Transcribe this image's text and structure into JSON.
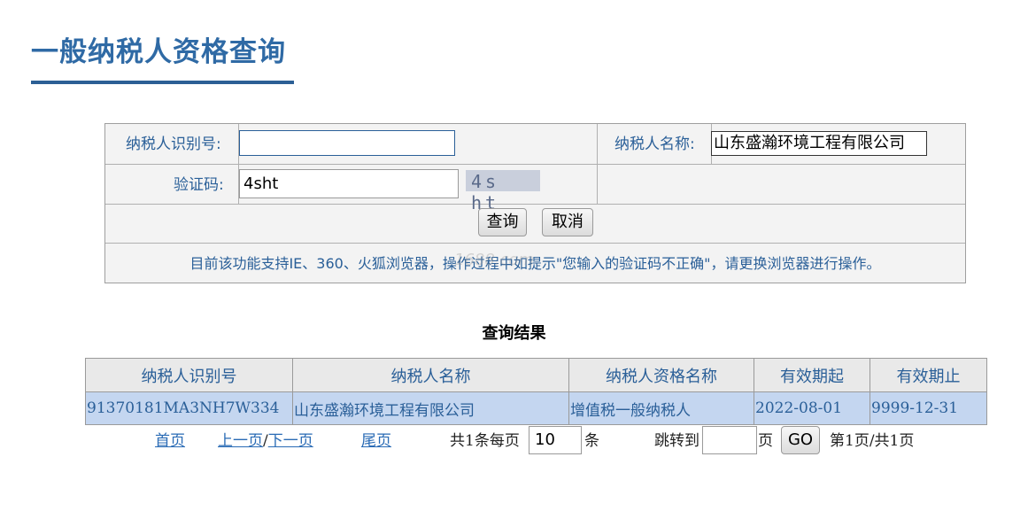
{
  "page": {
    "title": "一般纳税人资格查询"
  },
  "form": {
    "taxpayer_id_label": "纳税人识别号:",
    "taxpayer_id_value": "",
    "taxpayer_name_label": "纳税人名称:",
    "taxpayer_name_value": "山东盛瀚环境工程有限公司",
    "captcha_label": "验证码:",
    "captcha_value": "4sht",
    "captcha_image_text": "4s ht",
    "query_button": "查询",
    "cancel_button": "取消",
    "notice": "目前该功能支持IE、360、火狐浏览器，操作过程中如提示\"您输入的验证码不正确\"，请更换浏览器进行操作。",
    "watermark": "1688.com"
  },
  "results": {
    "caption": "查询结果",
    "columns": [
      "纳税人识别号",
      "纳税人名称",
      "纳税人资格名称",
      "有效期起",
      "有效期止"
    ],
    "rows": [
      [
        "91370181MA3NH7W334",
        "山东盛瀚环境工程有限公司",
        "增值税一般纳税人",
        "2022-08-01",
        "9999-12-31"
      ]
    ]
  },
  "pagination": {
    "first": "首页",
    "prev": "上一页",
    "separator": "/",
    "next": "下一页",
    "last": "尾页",
    "total_prefix": "共1条每页",
    "per_page": "10",
    "per_page_suffix": "条",
    "jump_label": "跳转到",
    "jump_value": "",
    "page_suffix": "页",
    "go_button": "GO",
    "page_info": "第1页/共1页"
  },
  "colors": {
    "title": "#2f6aa5",
    "label": "#2a5f98",
    "row_highlight": "#c4d6f0",
    "link": "#2a6bb5"
  }
}
